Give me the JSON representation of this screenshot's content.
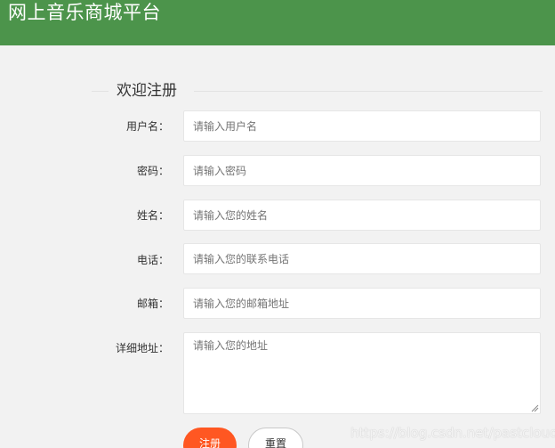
{
  "header": {
    "title": "网上音乐商城平台",
    "background_color": "#4c944b"
  },
  "form": {
    "legend": "欢迎注册",
    "fields": [
      {
        "label": "用户名：",
        "placeholder": "请输入用户名"
      },
      {
        "label": "密码：",
        "placeholder": "请输入密码"
      },
      {
        "label": "姓名：",
        "placeholder": "请输入您的姓名"
      },
      {
        "label": "电话：",
        "placeholder": "请输入您的联系电话"
      },
      {
        "label": "邮箱：",
        "placeholder": "请输入您的邮箱地址"
      }
    ],
    "address": {
      "label": "详细地址：",
      "placeholder": "请输入您的地址"
    },
    "buttons": {
      "register": "注册",
      "reset": "重置"
    },
    "primary_color": "#ff5722"
  },
  "watermark": "https://blog.csdn.net/pastclouds"
}
